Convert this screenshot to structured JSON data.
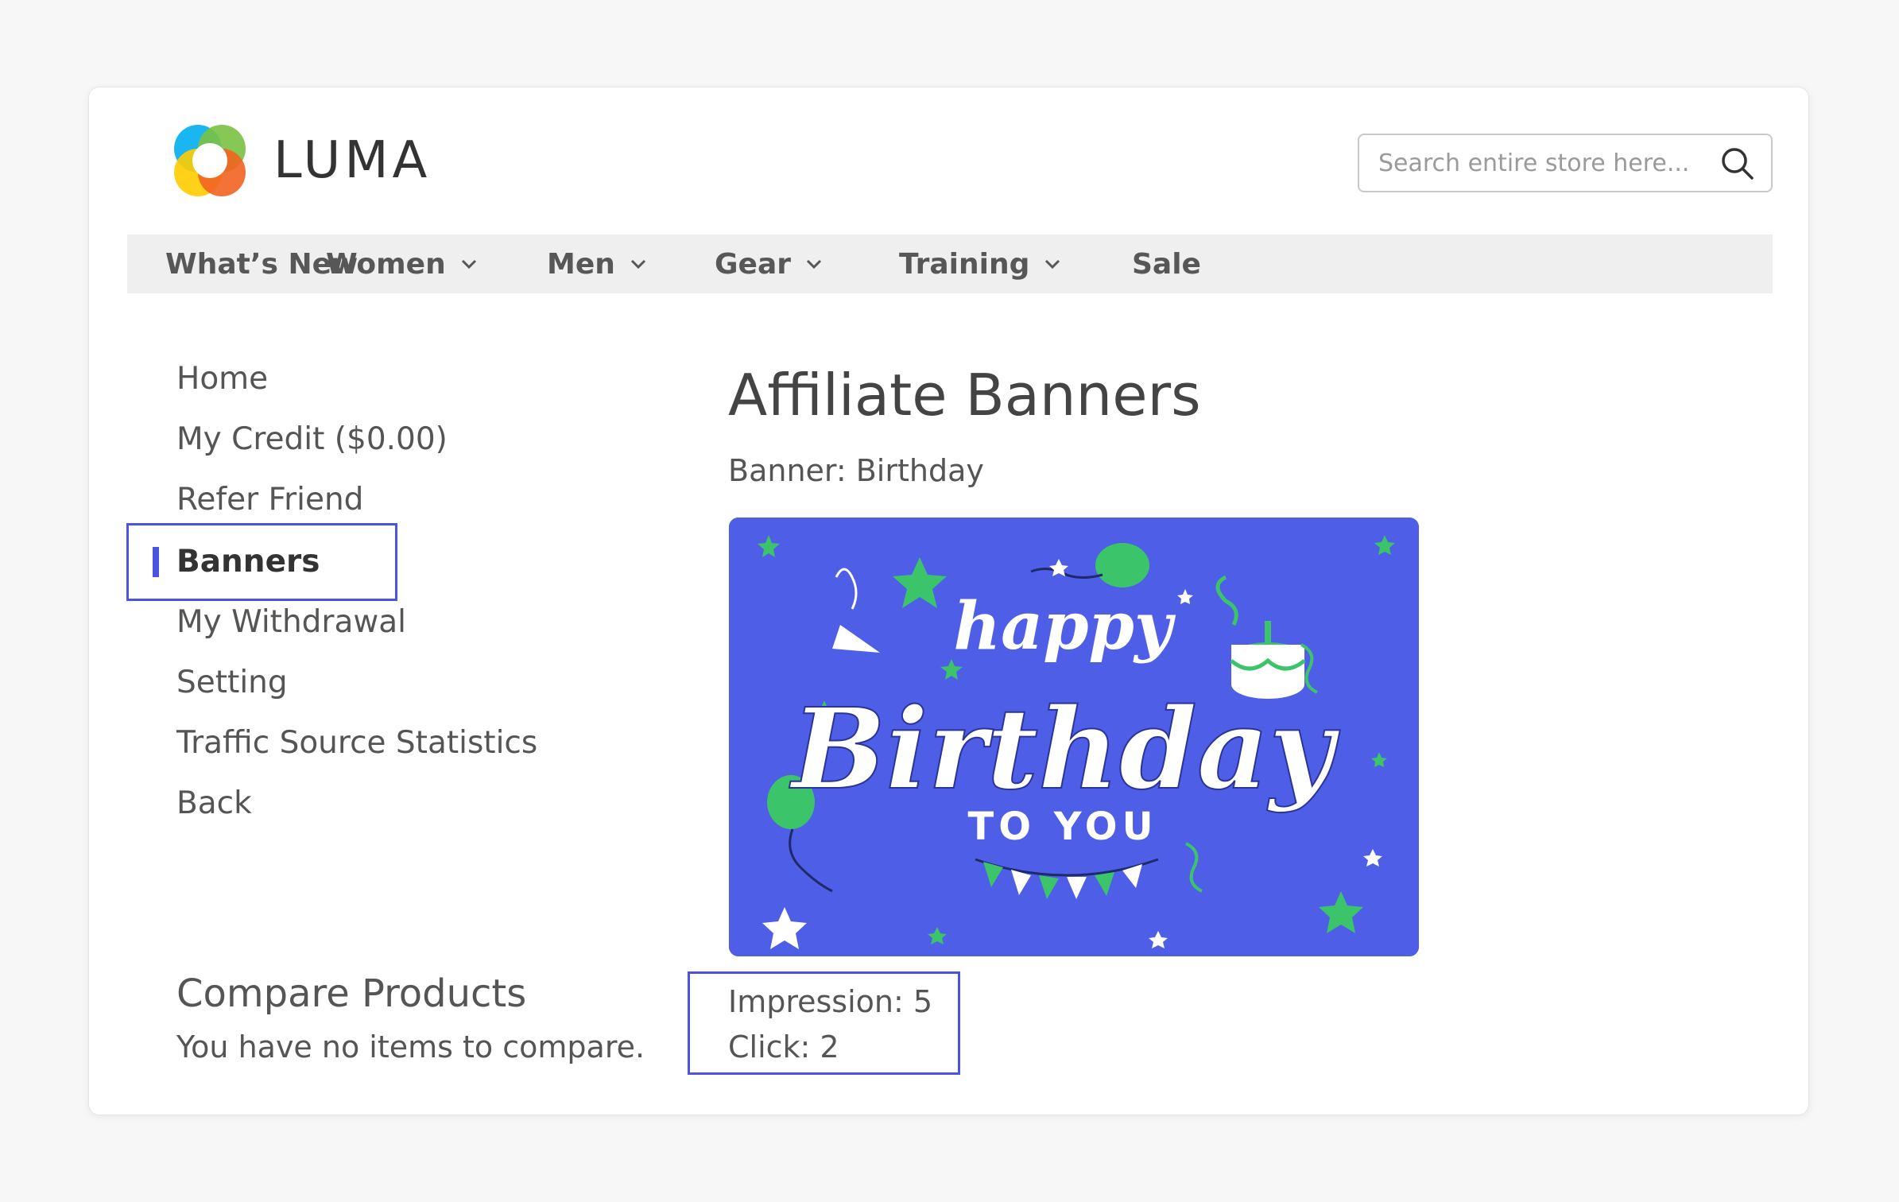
{
  "header": {
    "brand": "LUMA",
    "search": {
      "placeholder": "Search entire store here...",
      "value": ""
    }
  },
  "nav": {
    "items": [
      {
        "label": "What’s New",
        "has_dropdown": false
      },
      {
        "label": "Women",
        "has_dropdown": true
      },
      {
        "label": "Men",
        "has_dropdown": true
      },
      {
        "label": "Gear",
        "has_dropdown": true
      },
      {
        "label": "Training",
        "has_dropdown": true
      },
      {
        "label": "Sale",
        "has_dropdown": false
      }
    ]
  },
  "sidebar": {
    "items": [
      {
        "label": "Home"
      },
      {
        "label": "My Credit ($0.00)"
      },
      {
        "label": "Refer Friend"
      },
      {
        "label": "Banners",
        "active": true
      },
      {
        "label": "My Withdrawal"
      },
      {
        "label": "Setting"
      },
      {
        "label": "Traffic Source Statistics"
      },
      {
        "label": "Back"
      }
    ]
  },
  "main": {
    "title": "Affiliate Banners",
    "banner_name": "Banner: Birthday",
    "banner_image": {
      "text_line1": "happy",
      "text_line2": "Birthday",
      "text_line3": "TO YOU"
    },
    "stats": {
      "impression": "Impression: 5",
      "click": "Click: 2"
    }
  },
  "compare": {
    "title": "Compare Products",
    "text": "You have no items to compare."
  },
  "colors": {
    "accent": "#4a54e1",
    "banner_bg": "#4f5ee6",
    "banner_green": "#3cc46a",
    "logo_orange": "#f26322",
    "logo_yellow": "#ffcc00",
    "logo_green": "#7ac142",
    "logo_blue": "#00aeef"
  },
  "icons": {
    "search": "search-icon",
    "dropdown": "chevron-down-icon",
    "logo": "luma-logo-icon"
  }
}
